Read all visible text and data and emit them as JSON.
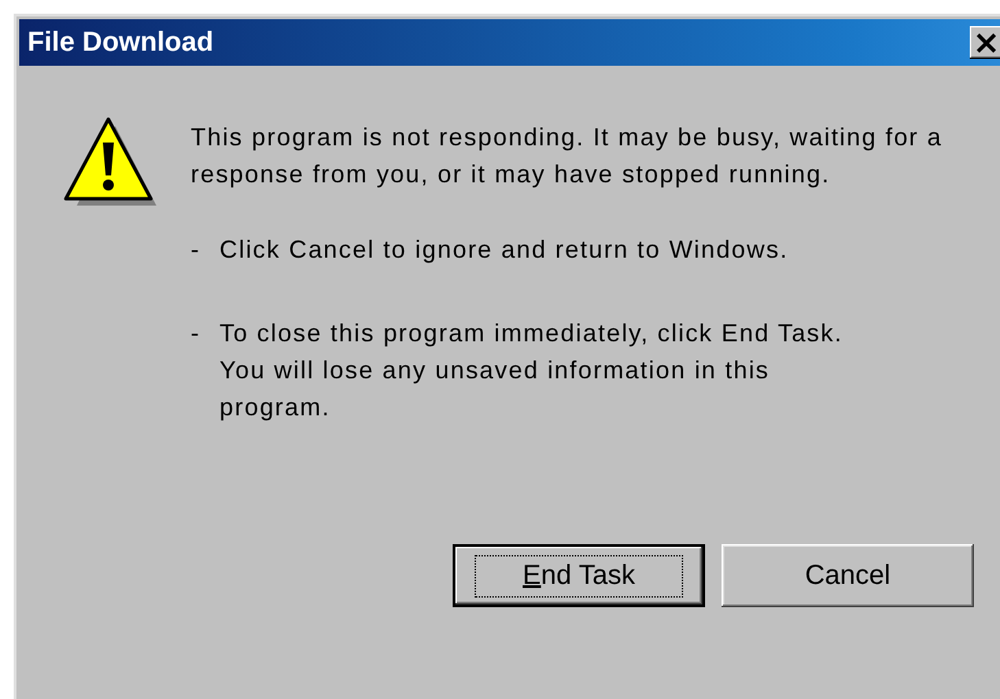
{
  "window": {
    "title": "File Download",
    "close": "×"
  },
  "message": "This program is not responding. It may be busy, waiting for a response from you, or it may have stopped running.",
  "bullets": [
    {
      "marker": "-",
      "text": "Click Cancel to ignore and return to Windows."
    },
    {
      "marker": "-",
      "text": "To close this program immediately, click End Task. You will lose any unsaved information in this program."
    }
  ],
  "buttons": [
    {
      "label": "End Task",
      "default": true,
      "mnemonic_underlined": true
    },
    {
      "label": "Cancel",
      "default": false
    }
  ]
}
